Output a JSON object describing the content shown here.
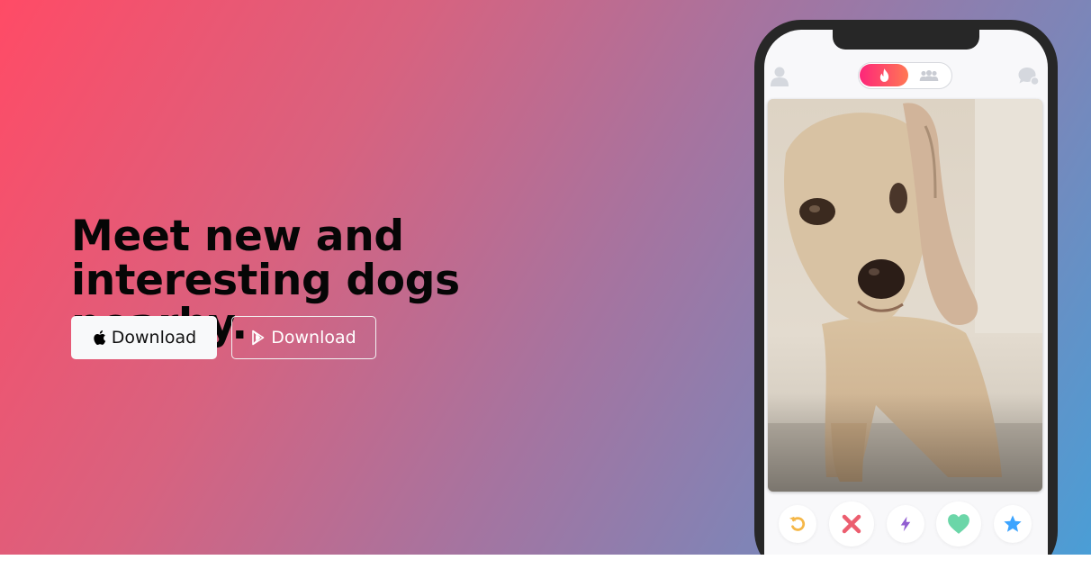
{
  "hero": {
    "headline": "Meet new and interesting dogs nearby.",
    "apple_button_label": "Download",
    "play_button_label": "Download",
    "gradient": [
      "#ff4b66",
      "#a574a0",
      "#4a9ed6"
    ]
  },
  "phone": {
    "icons": {
      "profile": "user-icon",
      "toggle_active": "flame-icon",
      "toggle_inactive": "group-icon",
      "messages": "chat-icon"
    },
    "card": {
      "photo": "dog-photo"
    },
    "actions": [
      {
        "name": "rewind",
        "icon": "rewind-icon",
        "color": "#f5b748"
      },
      {
        "name": "nope",
        "icon": "close-icon",
        "color": "#ec5e6f"
      },
      {
        "name": "boost",
        "icon": "bolt-icon",
        "color": "#915dd1"
      },
      {
        "name": "like",
        "icon": "heart-icon",
        "color": "#6bd6a8"
      },
      {
        "name": "super-like",
        "icon": "star-icon",
        "color": "#3ca4ff"
      }
    ]
  }
}
